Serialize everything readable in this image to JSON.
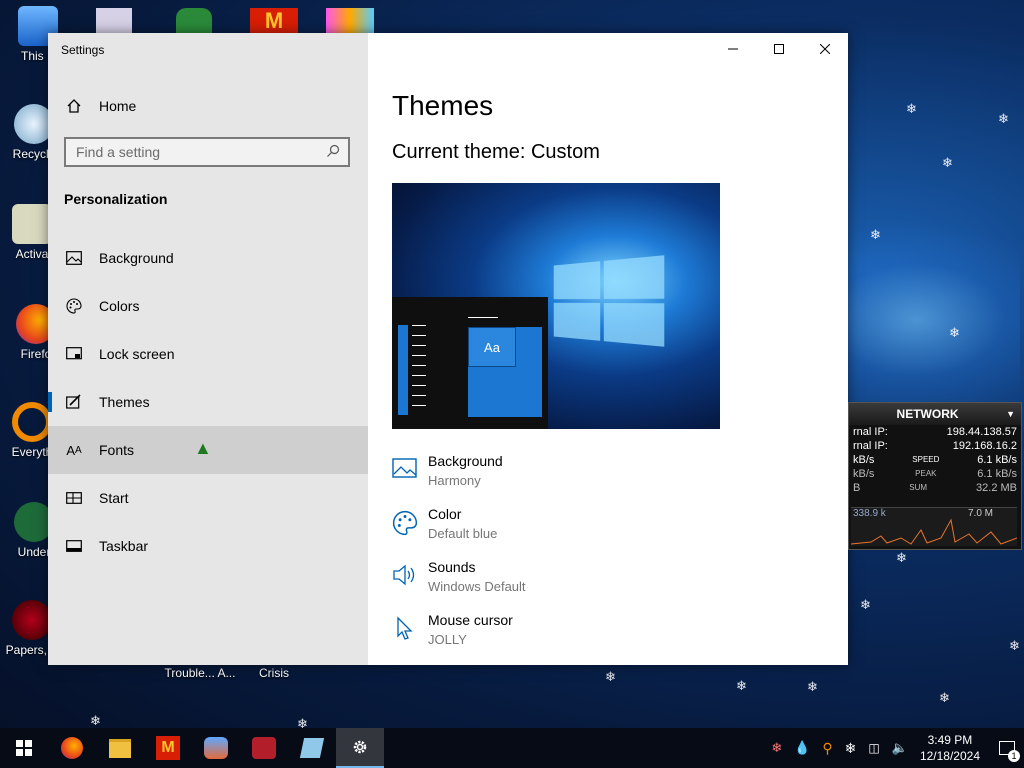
{
  "desktop": {
    "icons": [
      {
        "label": "This P"
      },
      {
        "label": "Recycle"
      },
      {
        "label": "Activa"
      },
      {
        "label": "Firefo"
      },
      {
        "label": "Everyth"
      },
      {
        "label": "Under"
      },
      {
        "label": "Papers, P"
      },
      {
        "label": "Trouble... A..."
      },
      {
        "label": "Crisis"
      }
    ]
  },
  "settings": {
    "window_title": "Settings",
    "home_label": "Home",
    "search_placeholder": "Find a setting",
    "section_title": "Personalization",
    "nav": [
      {
        "label": "Background",
        "icon": "picture-icon"
      },
      {
        "label": "Colors",
        "icon": "palette-icon"
      },
      {
        "label": "Lock screen",
        "icon": "lock-screen-icon"
      },
      {
        "label": "Themes",
        "icon": "themes-icon"
      },
      {
        "label": "Fonts",
        "icon": "fonts-icon"
      },
      {
        "label": "Start",
        "icon": "start-icon"
      },
      {
        "label": "Taskbar",
        "icon": "taskbar-icon"
      }
    ],
    "selected_nav": "Themes",
    "hovered_nav": "Fonts",
    "page_title": "Themes",
    "current_theme": "Current theme: Custom",
    "preview_text": "Aa",
    "theme_items": [
      {
        "name": "Background",
        "value": "Harmony",
        "icon": "picture-icon"
      },
      {
        "name": "Color",
        "value": "Default blue",
        "icon": "palette-icon"
      },
      {
        "name": "Sounds",
        "value": "Windows Default",
        "icon": "speaker-icon"
      },
      {
        "name": "Mouse cursor",
        "value": "JOLLY",
        "icon": "cursor-icon"
      }
    ],
    "accent_color": "#0063b1"
  },
  "network_widget": {
    "title": "NETWORK",
    "rows": [
      {
        "label": "rnal IP:",
        "value": "198.44.138.57"
      },
      {
        "label": "rnal IP:",
        "value": "192.168.16.2"
      },
      {
        "label": "kB/s",
        "mid": "SPEED",
        "value": "6.1 kB/s"
      },
      {
        "label": "kB/s",
        "mid": "PEAK",
        "value": "6.1 kB/s"
      },
      {
        "label": "B",
        "mid": "SUM",
        "value": "32.2 MB"
      }
    ],
    "graph_left": "338.9 k",
    "graph_right": "7.0 M"
  },
  "taskbar": {
    "time": "3:49 PM",
    "date": "12/18/2024",
    "notification_count": "1"
  }
}
